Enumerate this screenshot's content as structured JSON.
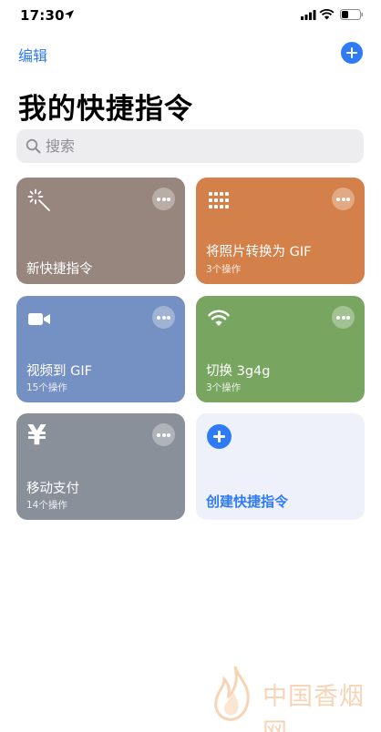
{
  "status_bar": {
    "time": "17:30"
  },
  "nav": {
    "edit_label": "编辑"
  },
  "title": "我的快捷指令",
  "search": {
    "placeholder": "搜索"
  },
  "shortcuts": [
    {
      "title": "新快捷指令",
      "subtitle": "",
      "color": "#97867e",
      "icon": "magic-wand-icon"
    },
    {
      "title": "将照片转换为 GIF",
      "subtitle": "3个操作",
      "color": "#d4804a",
      "icon": "grid-icon"
    },
    {
      "title": "视频到 GIF",
      "subtitle": "15个操作",
      "color": "#7590c2",
      "icon": "video-camera-icon"
    },
    {
      "title": "切换 3g4g",
      "subtitle": "3个操作",
      "color": "#78a660",
      "icon": "wifi-icon"
    },
    {
      "title": "移动支付",
      "subtitle": "14个操作",
      "color": "#8a909a",
      "icon": "yen-icon",
      "icon_glyph": "¥"
    },
    {
      "title": "创建快捷指令",
      "subtitle": "",
      "color": "#eef1fa",
      "icon": "plus-circle-icon"
    }
  ],
  "accent": "#2f7bf6",
  "watermark": {
    "text": "中国香烟网"
  }
}
